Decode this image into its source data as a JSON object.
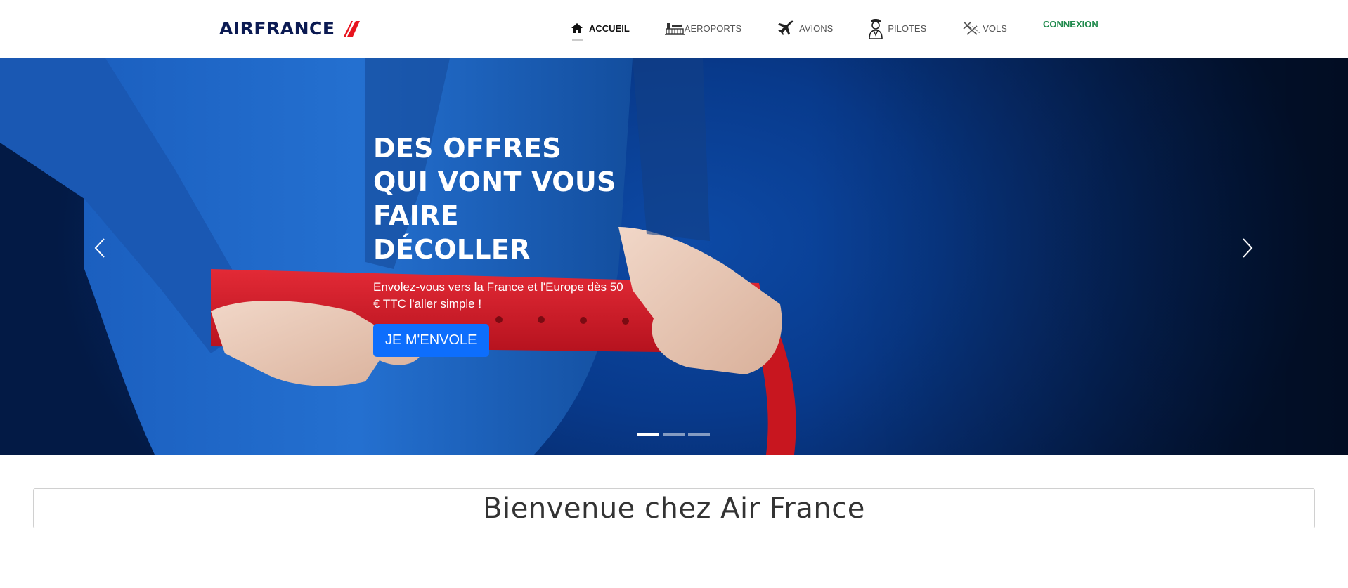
{
  "brand": {
    "name": "AIRFRANCE",
    "primary_color": "#0b1a52",
    "accent_color": "#e8141e"
  },
  "nav": {
    "items": [
      {
        "label": "ACCUEIL",
        "icon": "home-icon",
        "active": true
      },
      {
        "label": "AEROPORTS",
        "icon": "airport-icon",
        "active": false
      },
      {
        "label": "AVIONS",
        "icon": "airplane-icon",
        "active": false
      },
      {
        "label": "PILOTES",
        "icon": "pilot-icon",
        "active": false
      },
      {
        "label": "VOLS",
        "icon": "flights-icon",
        "active": false
      }
    ],
    "connexion_label": "CONNEXION",
    "connexion_color": "#1f8a4c"
  },
  "hero": {
    "title_lines": [
      "DES OFFRES",
      "QUI VONT VOUS",
      "FAIRE",
      "DÉCOLLER"
    ],
    "subtitle": "Envolez-vous vers la France et l'Europe dès 50 € TTC l'aller simple !",
    "button_label": "JE M'ENVOLE",
    "button_color": "#0d6efd",
    "slide_count": 3,
    "active_slide": 1
  },
  "welcome": {
    "title": "Bienvenue chez Air France"
  }
}
